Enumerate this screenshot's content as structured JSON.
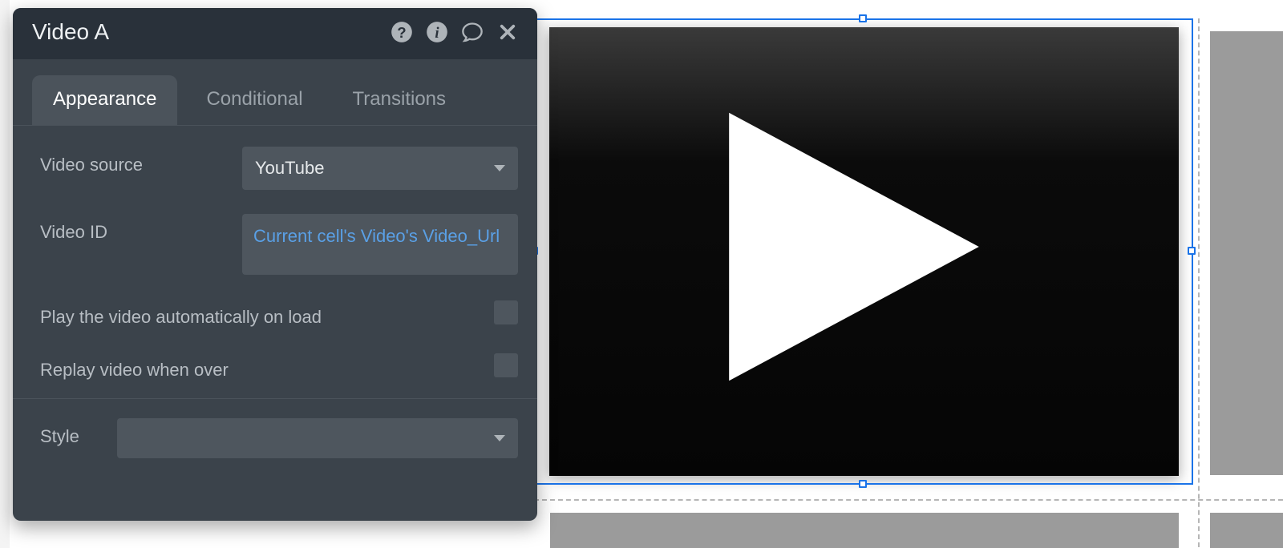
{
  "panel": {
    "title": "Video A",
    "tabs": {
      "appearance": "Appearance",
      "conditional": "Conditional",
      "transitions": "Transitions"
    },
    "fields": {
      "video_source_label": "Video source",
      "video_source_value": "YouTube",
      "video_id_label": "Video ID",
      "video_id_value": "Current cell's Video's Video_Url",
      "autoplay_label": "Play the video automatically on load",
      "replay_label": "Replay video when over",
      "style_label": "Style",
      "style_value": ""
    },
    "icons": {
      "help": "help-icon",
      "info": "info-icon",
      "comment": "comment-icon",
      "close": "close-icon"
    }
  }
}
